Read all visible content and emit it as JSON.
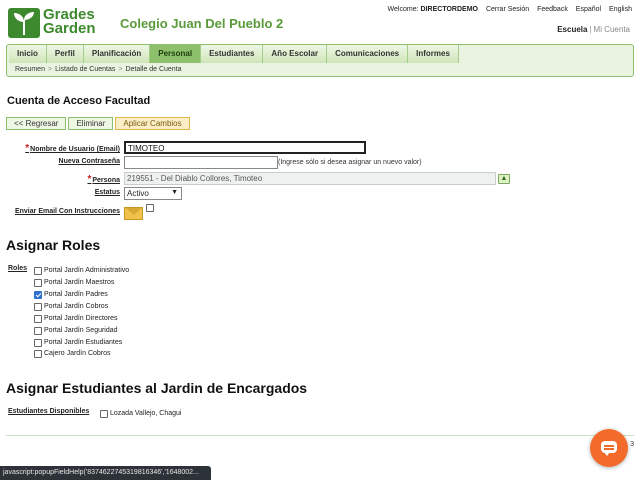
{
  "brand": {
    "logo_line1": "Grades",
    "logo_line2": "Garden",
    "school_name": "Colegio Juan Del Pueblo 2",
    "logo_color": "#3d8a2e"
  },
  "toplinks": {
    "welcome_label": "Welcome:",
    "user": "DIRECTORDEMO",
    "logout": "Cerrar Sesión",
    "feedback": "Feedback",
    "spanish": "Español",
    "english": "English"
  },
  "schoollinks": {
    "school": "Escuela",
    "separator": "|",
    "my_account": "Mi Cuenta"
  },
  "nav": {
    "tabs": [
      {
        "label": "Inicio",
        "selected": false
      },
      {
        "label": "Perfil",
        "selected": false
      },
      {
        "label": "Planificación",
        "selected": false
      },
      {
        "label": "Personal",
        "selected": true
      },
      {
        "label": "Estudiantes",
        "selected": false
      },
      {
        "label": "Año Escolar",
        "selected": false
      },
      {
        "label": "Comunicaciones",
        "selected": false
      },
      {
        "label": "Informes",
        "selected": false
      }
    ],
    "breadcrumb": [
      "Resumen",
      "Listado de Cuentas",
      "Detalle de Cuenta"
    ],
    "breadcrumb_sep": ">"
  },
  "page": {
    "title": "Cuenta de Acceso Facultad"
  },
  "buttons": {
    "back": "<< Regresar",
    "delete": "Eliminar",
    "apply": "Aplicar Cambios"
  },
  "form": {
    "required_mark": "*",
    "username_label": "Nombre de Usuario (Email)",
    "username_value": "TIMOTEO",
    "password_label": "Nueva Contraseña",
    "password_value": "",
    "password_hint": "(Ingrese sólo si desea asignar un nuevo valor)",
    "person_label": "Persona",
    "person_value": "219551 - Del Diablo Collores, Timoteo",
    "lookup_glyph": "▲",
    "status_label": "Estatus",
    "status_value": "Activo",
    "status_arrow": "▼",
    "email_label": "Enviar Email Con Instrucciones",
    "email_checked": false
  },
  "roles": {
    "section_title": "Asignar Roles",
    "label": "Roles",
    "items": [
      {
        "label": "Portal Jardín Administrativo",
        "checked": false
      },
      {
        "label": "Portal Jardín Maestros",
        "checked": false
      },
      {
        "label": "Portal Jardín Padres",
        "checked": true
      },
      {
        "label": "Portal Jardín Cobros",
        "checked": false
      },
      {
        "label": "Portal Jardín Directores",
        "checked": false
      },
      {
        "label": "Portal Jardín Seguridad",
        "checked": false
      },
      {
        "label": "Portal Jardín Estudiantes",
        "checked": false
      },
      {
        "label": "Cajero Jardín Cobros",
        "checked": false
      }
    ]
  },
  "students": {
    "section_title": "Asignar Estudiantes al Jardin de Encargados",
    "label": "Estudiantes Disponibles",
    "items": [
      {
        "label": "Lozada Vallejo, Chagui",
        "checked": false
      }
    ]
  },
  "footer": {
    "page_number": "3",
    "status_url": "javascript:popupFieldHelp('8374622745319816346','1648002..."
  }
}
